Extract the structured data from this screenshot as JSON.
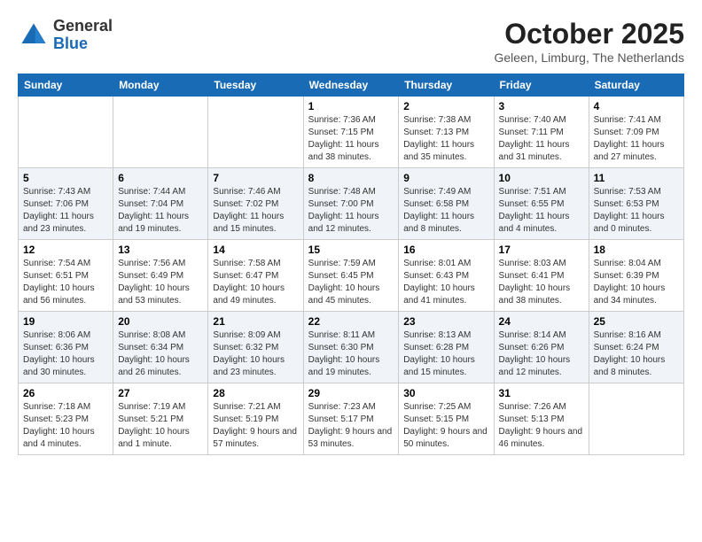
{
  "logo": {
    "general": "General",
    "blue": "Blue"
  },
  "title": "October 2025",
  "location": "Geleen, Limburg, The Netherlands",
  "days_of_week": [
    "Sunday",
    "Monday",
    "Tuesday",
    "Wednesday",
    "Thursday",
    "Friday",
    "Saturday"
  ],
  "weeks": [
    [
      {
        "day": "",
        "info": ""
      },
      {
        "day": "",
        "info": ""
      },
      {
        "day": "",
        "info": ""
      },
      {
        "day": "1",
        "info": "Sunrise: 7:36 AM\nSunset: 7:15 PM\nDaylight: 11 hours and 38 minutes."
      },
      {
        "day": "2",
        "info": "Sunrise: 7:38 AM\nSunset: 7:13 PM\nDaylight: 11 hours and 35 minutes."
      },
      {
        "day": "3",
        "info": "Sunrise: 7:40 AM\nSunset: 7:11 PM\nDaylight: 11 hours and 31 minutes."
      },
      {
        "day": "4",
        "info": "Sunrise: 7:41 AM\nSunset: 7:09 PM\nDaylight: 11 hours and 27 minutes."
      }
    ],
    [
      {
        "day": "5",
        "info": "Sunrise: 7:43 AM\nSunset: 7:06 PM\nDaylight: 11 hours and 23 minutes."
      },
      {
        "day": "6",
        "info": "Sunrise: 7:44 AM\nSunset: 7:04 PM\nDaylight: 11 hours and 19 minutes."
      },
      {
        "day": "7",
        "info": "Sunrise: 7:46 AM\nSunset: 7:02 PM\nDaylight: 11 hours and 15 minutes."
      },
      {
        "day": "8",
        "info": "Sunrise: 7:48 AM\nSunset: 7:00 PM\nDaylight: 11 hours and 12 minutes."
      },
      {
        "day": "9",
        "info": "Sunrise: 7:49 AM\nSunset: 6:58 PM\nDaylight: 11 hours and 8 minutes."
      },
      {
        "day": "10",
        "info": "Sunrise: 7:51 AM\nSunset: 6:55 PM\nDaylight: 11 hours and 4 minutes."
      },
      {
        "day": "11",
        "info": "Sunrise: 7:53 AM\nSunset: 6:53 PM\nDaylight: 11 hours and 0 minutes."
      }
    ],
    [
      {
        "day": "12",
        "info": "Sunrise: 7:54 AM\nSunset: 6:51 PM\nDaylight: 10 hours and 56 minutes."
      },
      {
        "day": "13",
        "info": "Sunrise: 7:56 AM\nSunset: 6:49 PM\nDaylight: 10 hours and 53 minutes."
      },
      {
        "day": "14",
        "info": "Sunrise: 7:58 AM\nSunset: 6:47 PM\nDaylight: 10 hours and 49 minutes."
      },
      {
        "day": "15",
        "info": "Sunrise: 7:59 AM\nSunset: 6:45 PM\nDaylight: 10 hours and 45 minutes."
      },
      {
        "day": "16",
        "info": "Sunrise: 8:01 AM\nSunset: 6:43 PM\nDaylight: 10 hours and 41 minutes."
      },
      {
        "day": "17",
        "info": "Sunrise: 8:03 AM\nSunset: 6:41 PM\nDaylight: 10 hours and 38 minutes."
      },
      {
        "day": "18",
        "info": "Sunrise: 8:04 AM\nSunset: 6:39 PM\nDaylight: 10 hours and 34 minutes."
      }
    ],
    [
      {
        "day": "19",
        "info": "Sunrise: 8:06 AM\nSunset: 6:36 PM\nDaylight: 10 hours and 30 minutes."
      },
      {
        "day": "20",
        "info": "Sunrise: 8:08 AM\nSunset: 6:34 PM\nDaylight: 10 hours and 26 minutes."
      },
      {
        "day": "21",
        "info": "Sunrise: 8:09 AM\nSunset: 6:32 PM\nDaylight: 10 hours and 23 minutes."
      },
      {
        "day": "22",
        "info": "Sunrise: 8:11 AM\nSunset: 6:30 PM\nDaylight: 10 hours and 19 minutes."
      },
      {
        "day": "23",
        "info": "Sunrise: 8:13 AM\nSunset: 6:28 PM\nDaylight: 10 hours and 15 minutes."
      },
      {
        "day": "24",
        "info": "Sunrise: 8:14 AM\nSunset: 6:26 PM\nDaylight: 10 hours and 12 minutes."
      },
      {
        "day": "25",
        "info": "Sunrise: 8:16 AM\nSunset: 6:24 PM\nDaylight: 10 hours and 8 minutes."
      }
    ],
    [
      {
        "day": "26",
        "info": "Sunrise: 7:18 AM\nSunset: 5:23 PM\nDaylight: 10 hours and 4 minutes."
      },
      {
        "day": "27",
        "info": "Sunrise: 7:19 AM\nSunset: 5:21 PM\nDaylight: 10 hours and 1 minute."
      },
      {
        "day": "28",
        "info": "Sunrise: 7:21 AM\nSunset: 5:19 PM\nDaylight: 9 hours and 57 minutes."
      },
      {
        "day": "29",
        "info": "Sunrise: 7:23 AM\nSunset: 5:17 PM\nDaylight: 9 hours and 53 minutes."
      },
      {
        "day": "30",
        "info": "Sunrise: 7:25 AM\nSunset: 5:15 PM\nDaylight: 9 hours and 50 minutes."
      },
      {
        "day": "31",
        "info": "Sunrise: 7:26 AM\nSunset: 5:13 PM\nDaylight: 9 hours and 46 minutes."
      },
      {
        "day": "",
        "info": ""
      }
    ]
  ]
}
